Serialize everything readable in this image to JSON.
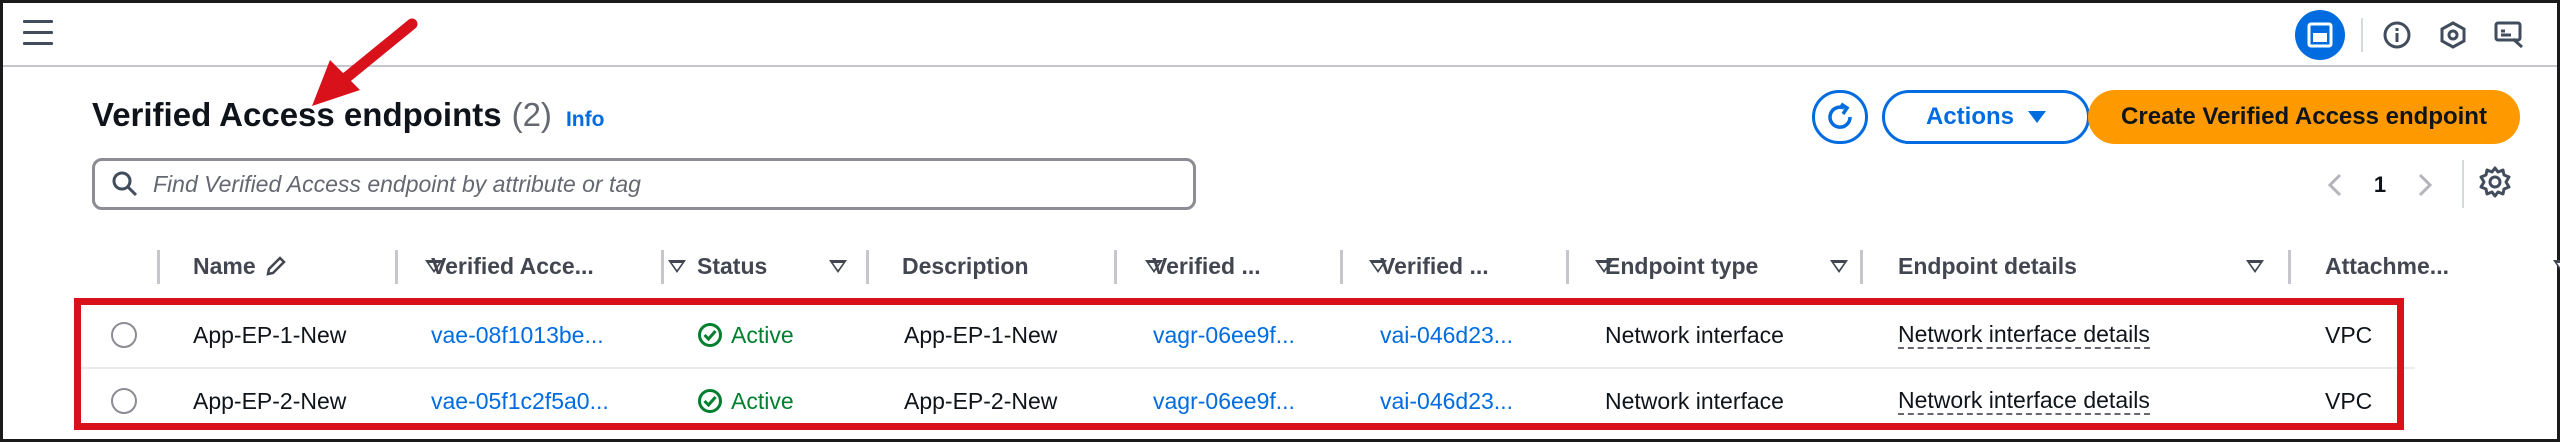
{
  "topbar": {
    "icons": [
      "menu-icon",
      "drawer-panel-icon",
      "info-circle-icon",
      "security-hexagon-icon",
      "feedback-icon"
    ]
  },
  "header": {
    "title": "Verified Access endpoints",
    "count": "(2)",
    "info": "Info"
  },
  "toolbar": {
    "actions_label": "Actions",
    "create_label": "Create Verified Access endpoint"
  },
  "search": {
    "placeholder": "Find Verified Access endpoint by attribute or tag"
  },
  "pagination": {
    "page": "1"
  },
  "table": {
    "columns": [
      "Name",
      "Verified Acce...",
      "Status",
      "Description",
      "Verified ...",
      "Verified ...",
      "Endpoint type",
      "Endpoint details",
      "Attachme..."
    ],
    "rows": [
      {
        "name": "App-EP-1-New",
        "endpoint_id": "vae-08f1013be...",
        "status": "Active",
        "description": "App-EP-1-New",
        "group_id": "vagr-06ee9f...",
        "instance_id": "vai-046d23...",
        "endpoint_type": "Network interface",
        "endpoint_details": "Network interface details",
        "attachment": "VPC"
      },
      {
        "name": "App-EP-2-New",
        "endpoint_id": "vae-05f1c2f5a0...",
        "status": "Active",
        "description": "App-EP-2-New",
        "group_id": "vagr-06ee9f...",
        "instance_id": "vai-046d23...",
        "endpoint_type": "Network interface",
        "endpoint_details": "Network interface details",
        "attachment": "VPC"
      }
    ]
  },
  "colors": {
    "link": "#006ce0",
    "primary_button": "#ff9900",
    "status_active": "#00802f",
    "annotation": "#d9111b"
  }
}
